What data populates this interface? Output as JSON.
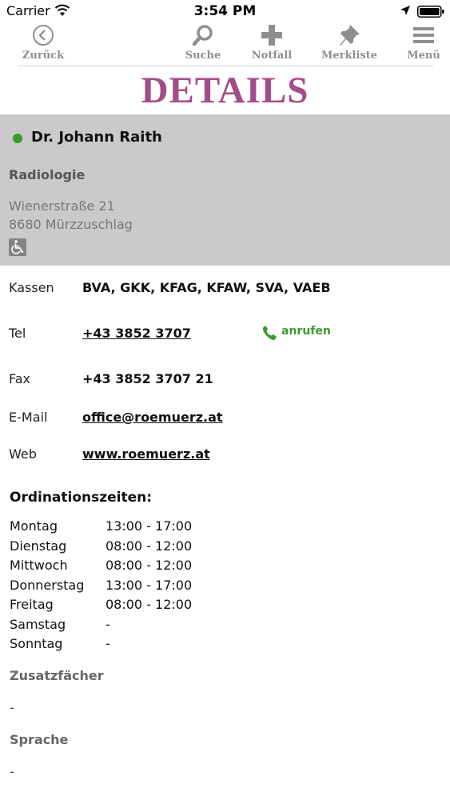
{
  "status_bar": {
    "carrier": "Carrier",
    "time": "3:54 PM"
  },
  "toolbar": {
    "back": "Zurück",
    "search": "Suche",
    "emergency": "Notfall",
    "bookmarks": "Merkliste",
    "menu": "Menü"
  },
  "page": {
    "title": "DETAILS"
  },
  "doctor": {
    "name": "Dr. Johann Raith",
    "specialty": "Radiologie",
    "street": "Wienerstraße 21",
    "city": "8680 Mürzzuschlag",
    "status_color": "#3c9a2f",
    "accessible_icon": "wheelchair-icon"
  },
  "details": {
    "insurance_label": "Kassen",
    "insurance_value": "BVA, GKK, KFAG, KFAW, SVA, VAEB",
    "phone_label": "Tel",
    "phone_value": "+43 3852 3707",
    "call_label": "anrufen",
    "fax_label": "Fax",
    "fax_value": "+43 3852 3707 21",
    "email_label": "E-Mail",
    "email_value": "office@roemuerz.at",
    "web_label": "Web",
    "web_value": "www.roemuerz.at"
  },
  "hours": {
    "heading": "Ordinationszeiten:",
    "rows": [
      {
        "day": "Montag",
        "time": "13:00 - 17:00"
      },
      {
        "day": "Dienstag",
        "time": "08:00 - 12:00"
      },
      {
        "day": "Mittwoch",
        "time": "08:00 - 12:00"
      },
      {
        "day": "Donnerstag",
        "time": "13:00 - 17:00"
      },
      {
        "day": "Freitag",
        "time": "08:00 - 12:00"
      },
      {
        "day": "Samstag",
        "time": "-"
      },
      {
        "day": "Sonntag",
        "time": "-"
      }
    ]
  },
  "extra": {
    "additional_label": "Zusatzfächer",
    "additional_value": "-",
    "language_label": "Sprache",
    "language_value": "-"
  },
  "colors": {
    "accent": "#a44b89",
    "green": "#3c9a2f",
    "card_bg": "#cacaca"
  }
}
